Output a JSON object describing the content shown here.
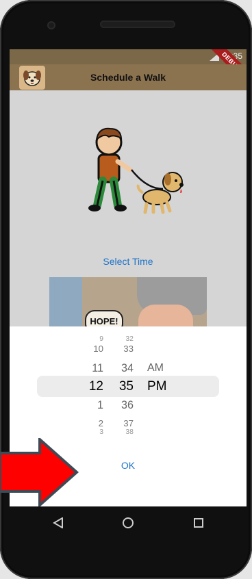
{
  "status": {
    "time": "12:35"
  },
  "debug_banner": "DEBUG",
  "appbar": {
    "title": "Schedule a Walk"
  },
  "select_time_label": "Select Time",
  "photo_text": "HOPE!",
  "time_picker": {
    "hours": [
      "9",
      "10",
      "11",
      "12",
      "1",
      "2",
      "3"
    ],
    "minutes": [
      "32",
      "33",
      "34",
      "35",
      "36",
      "37",
      "38"
    ],
    "periods": [
      "AM",
      "PM"
    ],
    "selected": {
      "hour": "12",
      "minute": "35",
      "period": "PM"
    }
  },
  "ok_label": "OK",
  "colors": {
    "accent": "#1e73c8",
    "appbar": "#8c7350",
    "arrow": "#ff0000"
  }
}
